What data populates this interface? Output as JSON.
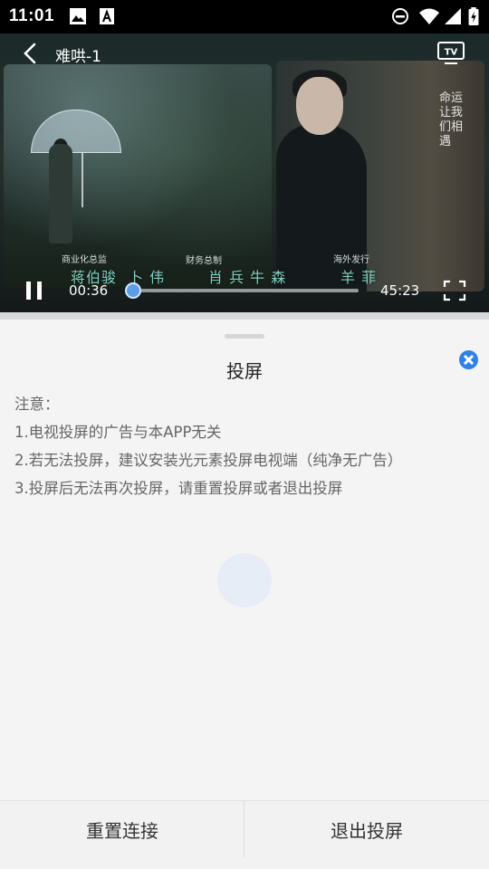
{
  "status_bar": {
    "time": "11:01",
    "icons": [
      "image-icon",
      "a-badge-icon",
      "do-not-disturb-icon",
      "wifi-icon",
      "signal-icon",
      "battery-charging-icon"
    ]
  },
  "player": {
    "title": "难哄-1",
    "current_time": "00:36",
    "total_time": "45:23",
    "progress": 0.013,
    "credits": [
      "商业化总监",
      "财务总制",
      "海外发行"
    ],
    "cast": [
      "蒋伯骏",
      "卜 伟",
      "肖 兵 牛 森",
      "羊 菲"
    ],
    "poster_text": "命运让我们相遇",
    "icons": [
      "back-arrow-icon",
      "tv-cast-icon",
      "pause-icon",
      "fullscreen-icon"
    ]
  },
  "cast_sheet": {
    "title": "投屏",
    "notice_label": "注意：",
    "notices": [
      "1.电视投屏的广告与本APP无关",
      "2.若无法投屏，建议安装光元素投屏电视端（纯净无广告）",
      "3.投屏后无法再次投屏，请重置投屏或者退出投屏"
    ],
    "buttons": {
      "reset": "重置连接",
      "exit": "退出投屏"
    },
    "colors": {
      "accent": "#2f80e8"
    }
  }
}
